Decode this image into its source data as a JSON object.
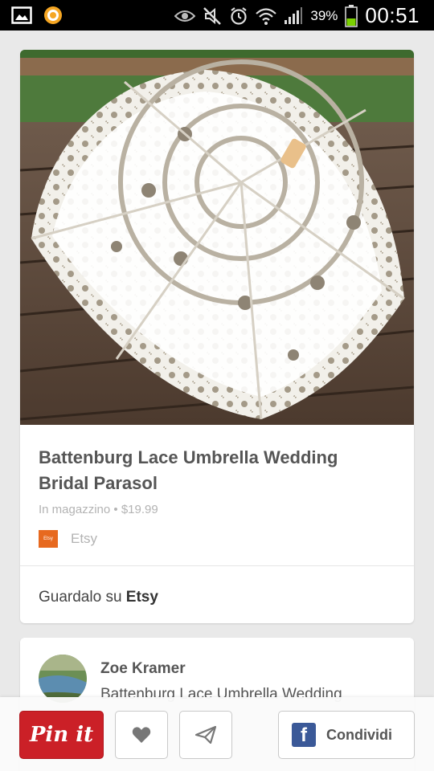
{
  "status_bar": {
    "battery": "39%",
    "time": "00:51",
    "icons": [
      "gallery-icon",
      "app-notification-icon",
      "eye-icon",
      "mute-icon",
      "alarm-icon",
      "wifi-icon",
      "signal-icon",
      "battery-icon"
    ]
  },
  "pin": {
    "title": "Battenburg Lace Umbrella Wedding Bridal Parasol",
    "availability": "In magazzino",
    "separator": "•",
    "price": "$19.99",
    "source_badge": "Etsy",
    "source_name": "Etsy",
    "view_prefix": "Guardalo su",
    "view_source": "Etsy"
  },
  "pinner": {
    "name": "Zoe Kramer",
    "board_title": "Battenburg Lace Umbrella Wedding"
  },
  "toolbar": {
    "pinit_label": "Pin it",
    "share_label": "Condividi",
    "icons": [
      "heart-icon",
      "send-icon",
      "facebook-icon"
    ]
  },
  "colors": {
    "pinit_red": "#cb2027",
    "facebook_blue": "#3b5998",
    "etsy_orange": "#e7691f",
    "battery_green": "#7bd100"
  }
}
